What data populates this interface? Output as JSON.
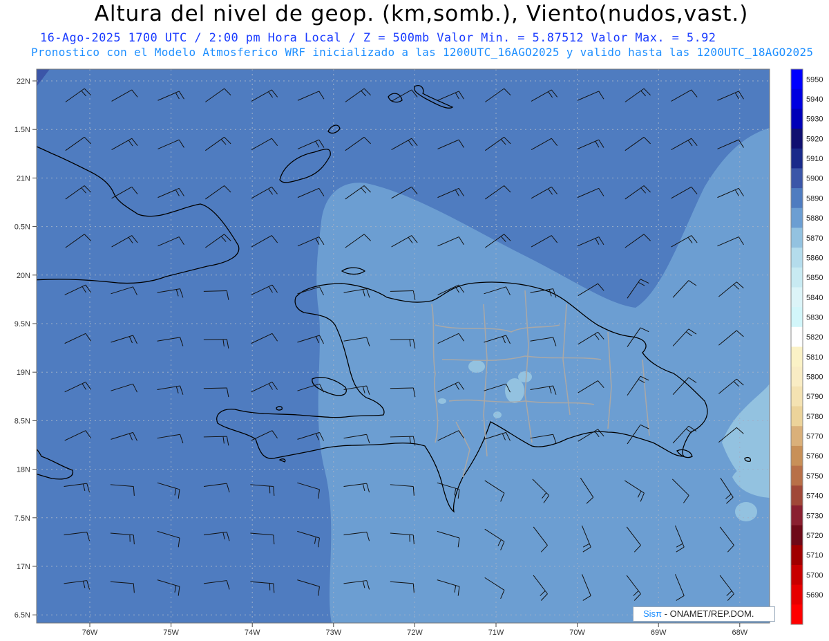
{
  "header": {
    "title": "Altura del nivel de geop. (km,somb.), Viento(nudos,vast.)",
    "line1": "16-Ago-2025  1700 UTC / 2:00 pm Hora Local / Z = 500mb      Valor Min. = 5.87512  Valor Max. = 5.92",
    "line2": "Pronostico con el Modelo Atmosferico WRF inicializado a las 1200UTC_16AGO2025 y valido hasta las  1200UTC_18AGO2025"
  },
  "axes": {
    "lat_labels": [
      "22N",
      "1.5N",
      "21N",
      "0.5N",
      "20N",
      "9.5N",
      "19N",
      "8.5N",
      "18N",
      "7.5N",
      "17N",
      "6.5N"
    ],
    "lon_labels": [
      "76W",
      "75W",
      "74W",
      "73W",
      "72W",
      "71W",
      "70W",
      "69W",
      "68W"
    ]
  },
  "colorbar": {
    "levels": [
      "5950",
      "5940",
      "5930",
      "5920",
      "5910",
      "5900",
      "5890",
      "5880",
      "5870",
      "5860",
      "5850",
      "5840",
      "5830",
      "5820",
      "5810",
      "5800",
      "5790",
      "5780",
      "5770",
      "5760",
      "5750",
      "5740",
      "5730",
      "5720",
      "5710",
      "5700",
      "5690"
    ],
    "colors": [
      "#0000ff",
      "#0000e0",
      "#0000b8",
      "#101070",
      "#1a2a8a",
      "#3b56a8",
      "#4f7cc0",
      "#6c9ed2",
      "#93c2e0",
      "#b4dcec",
      "#c8eaf2",
      "#dcf4f8",
      "#d2f6fa",
      "#ffffff",
      "#fbf2c6",
      "#f9ecc4",
      "#f4e2b2",
      "#ecd39a",
      "#dab07a",
      "#c89058",
      "#b87048",
      "#a04838",
      "#8a2030",
      "#6e0a18",
      "#a00000",
      "#c80000",
      "#e60000",
      "#ff0000"
    ]
  },
  "field": {
    "background_color": "#4f7cc0",
    "region_5880_color": "#6c9ed2",
    "region_5870_color": "#93c2e0"
  },
  "credit": {
    "brand": "Sisπ",
    "org": "- ONAMET/REP.DOM."
  }
}
